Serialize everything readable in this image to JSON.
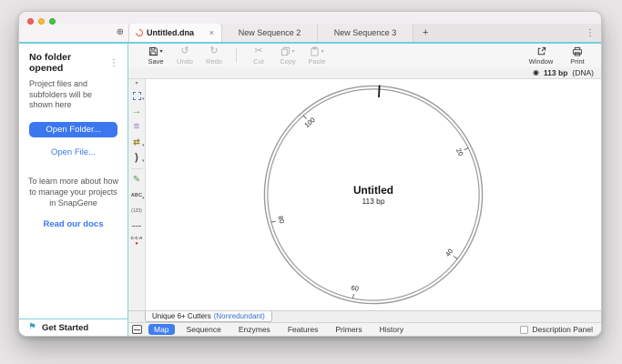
{
  "colors": {
    "accent_teal": "#74ccdd",
    "primary_blue": "#3b77ee",
    "tab_pill_blue": "#3f7df0",
    "logo_red": "#e0584a",
    "ring_gray": "#9a9a9a"
  },
  "tabs": {
    "items": [
      {
        "label": "Untitled.dna",
        "active": true
      },
      {
        "label": "New Sequence 2",
        "active": false
      },
      {
        "label": "New Sequence 3",
        "active": false
      }
    ],
    "add_label": "+"
  },
  "sidebar": {
    "header": "No folder opened",
    "intro": "Project files and subfolders will be shown here",
    "open_folder": "Open Folder...",
    "open_file": "Open File...",
    "learn_text": "To learn more about how to manage your projects in SnapGene",
    "docs_link": "Read our docs",
    "get_started": "Get Started"
  },
  "toolbar": {
    "save": "Save",
    "undo": "Undo",
    "redo": "Redo",
    "cut": "Cut",
    "copy": "Copy",
    "paste": "Paste",
    "window": "Window",
    "print": "Print"
  },
  "statusbar": {
    "length": "113 bp",
    "type": "(DNA)"
  },
  "toolstrip": {
    "abc_label": "ABC",
    "num_label": "(123)",
    "cca_label": "C·C·A"
  },
  "plasmid": {
    "name": "Untitled",
    "length_label": "113 bp",
    "total_bp": 113,
    "origin_pos": 1,
    "ticks": [
      {
        "label": "20",
        "pos": 20
      },
      {
        "label": "40",
        "pos": 40
      },
      {
        "label": "60",
        "pos": 60
      },
      {
        "label": "80",
        "pos": 80
      },
      {
        "label": "100",
        "pos": 100
      }
    ]
  },
  "enzyme_tab": {
    "label": "Unique 6+ Cutters",
    "qualifier": "(Nonredundant)"
  },
  "view_tabs": [
    "Map",
    "Sequence",
    "Enzymes",
    "Features",
    "Primers",
    "History"
  ],
  "description_panel": {
    "label": "Description Panel"
  }
}
